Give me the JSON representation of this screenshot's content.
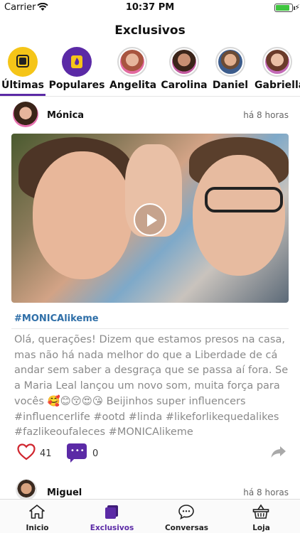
{
  "status_bar": {
    "carrier": "Carrier",
    "time": "10:37 PM",
    "battery_level": 0.85
  },
  "nav": {
    "title": "Exclusivos"
  },
  "stories": [
    {
      "label": "Últimas",
      "icon": "latest-icon",
      "color": "#f5c518",
      "active": true
    },
    {
      "label": "Populares",
      "icon": "flame-icon",
      "color": "#5b2aa6",
      "active": false
    },
    {
      "label": "Angelita",
      "icon": "avatar",
      "active": false
    },
    {
      "label": "Carolina",
      "icon": "avatar",
      "active": false
    },
    {
      "label": "Daniel",
      "icon": "avatar",
      "active": false
    },
    {
      "label": "Gabriella",
      "icon": "avatar",
      "active": false
    }
  ],
  "post": {
    "author": "Mónica",
    "time_ago": "há 8 horas",
    "hashtag": "#MONICAlikeme",
    "caption": "Olá, querações! Dizem que estamos presos na casa, mas não há nada melhor do que a Liberdade de cá andar sem saber a desgraça que se passa aí fora. Se a Maria Leal lançou um novo som, muita força para vocês 🥰😊😚😍😘 Beijinhos super influencers #influencerlife #ootd #linda #likeforlikequedalikes #fazlikeoufaleces  #MONICAlikeme",
    "likes": "41",
    "comments": "0"
  },
  "post2": {
    "author": "Miguel",
    "time_ago": "há 8 horas"
  },
  "tabbar": {
    "items": [
      {
        "label": "Inicio",
        "icon": "home-icon"
      },
      {
        "label": "Exclusivos",
        "icon": "exclusive-icon",
        "active": true
      },
      {
        "label": "Conversas",
        "icon": "chat-icon"
      },
      {
        "label": "Loja",
        "icon": "basket-icon"
      }
    ]
  },
  "colors": {
    "accent": "#5b2aa6",
    "hashtag": "#2f6fa8",
    "like": "#d0262f"
  }
}
